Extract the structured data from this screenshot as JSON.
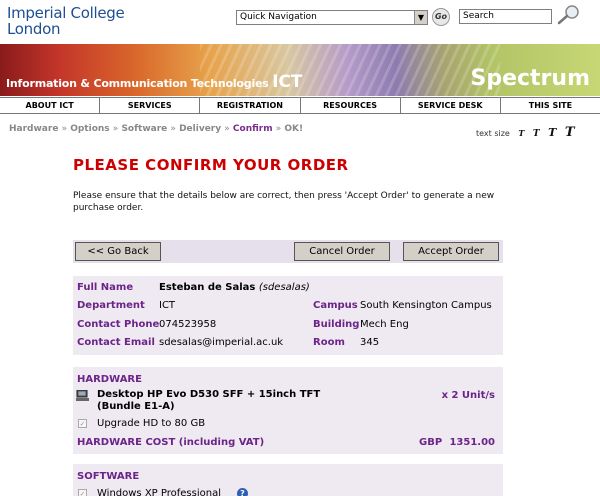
{
  "header": {
    "logo_line1": "Imperial College",
    "logo_line2": "London",
    "quick_nav": "Quick Navigation",
    "go_label": "Go",
    "search_placeholder": "Search"
  },
  "banner": {
    "dept_text": "Information & Communication Technologies",
    "ict": "ICT",
    "product": "Spectrum"
  },
  "nav": [
    "ABOUT ICT",
    "SERVICES",
    "REGISTRATION",
    "RESOURCES",
    "SERVICE DESK",
    "THIS SITE"
  ],
  "breadcrumb": {
    "steps": [
      "Hardware",
      "Options",
      "Software",
      "Delivery",
      "Confirm",
      "OK!"
    ],
    "sep": "»",
    "current_index": 4
  },
  "text_size": {
    "label": "text size",
    "options": [
      "T",
      "T",
      "T",
      "T"
    ]
  },
  "page": {
    "title": "PLEASE CONFIRM YOUR ORDER",
    "intro": "Please ensure that the details below are correct, then press 'Accept Order' to generate a new purchase order."
  },
  "buttons": {
    "back": "<< Go Back",
    "cancel": "Cancel Order",
    "accept": "Accept Order"
  },
  "user": {
    "full_name_label": "Full Name",
    "full_name": "Esteban de Salas",
    "username": "(sdesalas)",
    "department_label": "Department",
    "department": "ICT",
    "campus_label": "Campus",
    "campus": "South Kensington Campus",
    "phone_label": "Contact Phone",
    "phone": "074523958",
    "building_label": "Building",
    "building": "Mech Eng",
    "email_label": "Contact Email",
    "email": "sdesalas@imperial.ac.uk",
    "room_label": "Room",
    "room": "345"
  },
  "hardware": {
    "heading": "HARDWARE",
    "item_line1": "Desktop HP Evo D530 SFF + 15inch TFT",
    "item_line2": "(Bundle E1-A)",
    "quantity": "x 2 Unit/s",
    "option": "Upgrade HD to 80 GB",
    "cost_label": "HARDWARE COST (including VAT)",
    "cost_currency": "GBP",
    "cost_value": "1351.00"
  },
  "software": {
    "heading": "SOFTWARE",
    "first_item": "Windows XP Professional"
  }
}
